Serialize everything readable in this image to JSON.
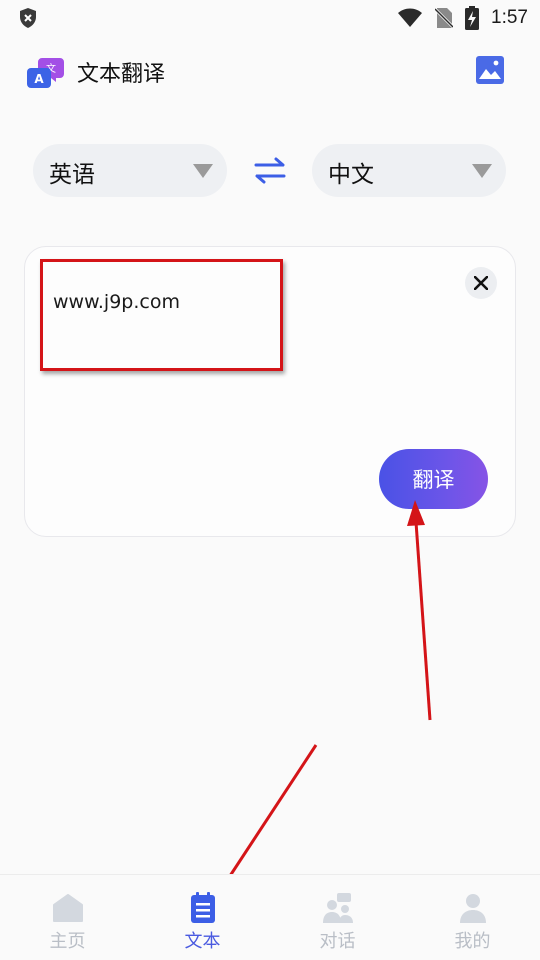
{
  "status_bar": {
    "time": "1:57"
  },
  "header": {
    "title": "文本翻译",
    "logo_icon": "translate-logo-icon",
    "action_icon": "image-icon"
  },
  "languages": {
    "source": "英语",
    "target": "中文",
    "swap_icon": "swap-arrows-icon"
  },
  "input": {
    "text": "www.j9p.com",
    "clear_icon": "close-icon"
  },
  "translate_button": {
    "label": "翻译"
  },
  "tabs": [
    {
      "label": "主页",
      "icon": "home-icon",
      "active": false
    },
    {
      "label": "文本",
      "icon": "document-icon",
      "active": true
    },
    {
      "label": "对话",
      "icon": "conversation-icon",
      "active": false
    },
    {
      "label": "我的",
      "icon": "profile-icon",
      "active": false
    }
  ],
  "colors": {
    "accent": "#4a5ae0",
    "button_gradient_start": "#4a52e6",
    "button_gradient_end": "#8654e6",
    "inactive_tab": "#b9bec6",
    "annotation_red": "#d41418"
  }
}
